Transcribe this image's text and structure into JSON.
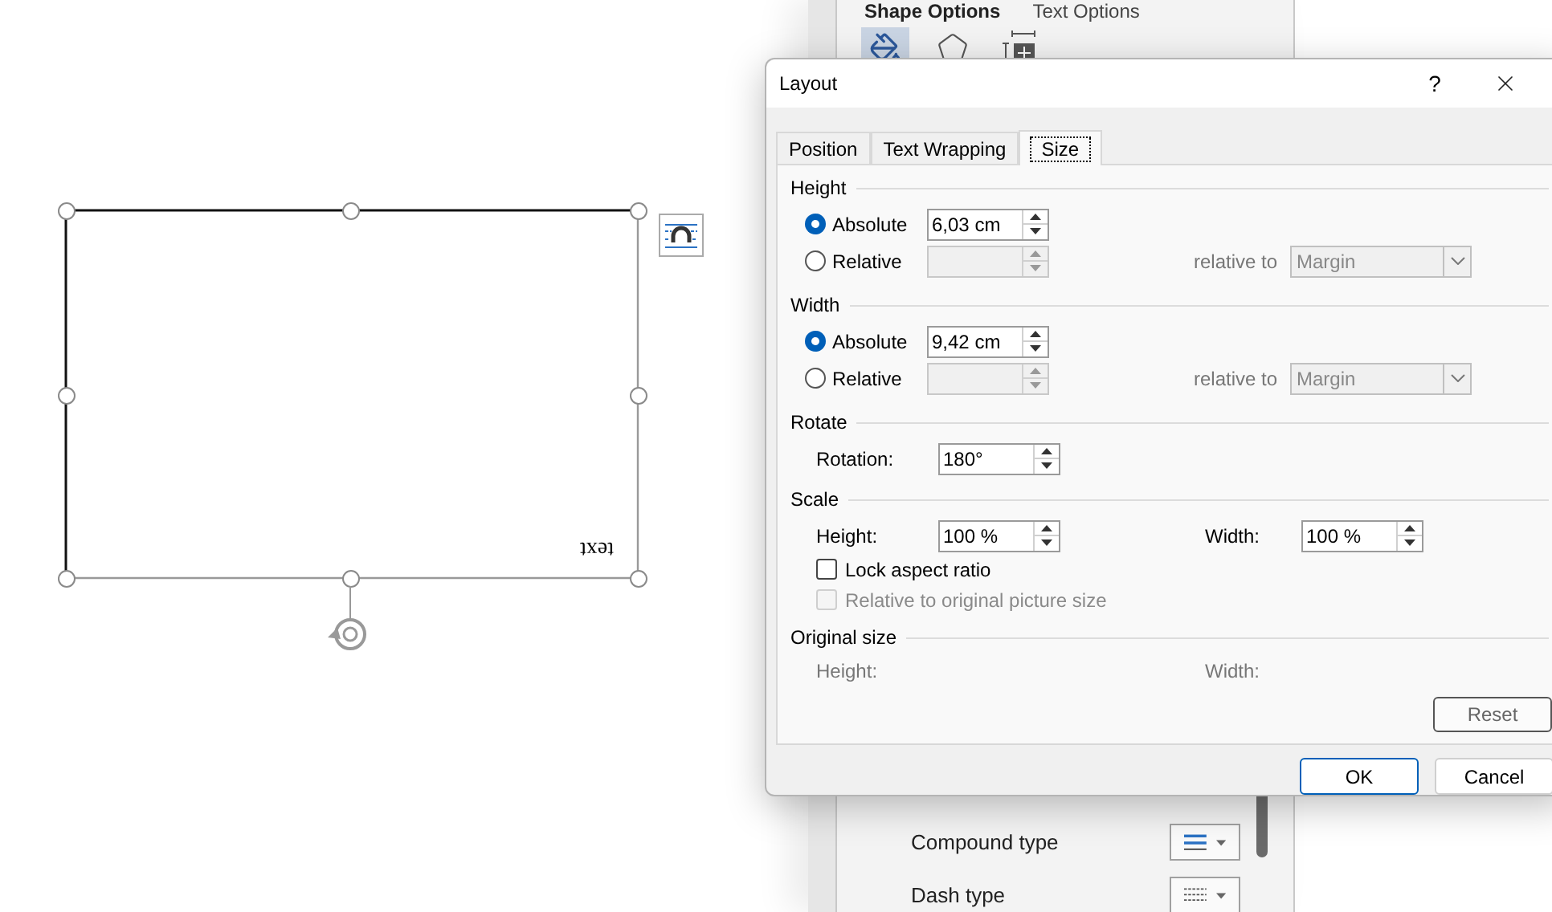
{
  "task_pane": {
    "tabs": [
      {
        "label": "Shape Options",
        "selected": true
      },
      {
        "label": "Text Options",
        "selected": false
      }
    ],
    "icons": [
      {
        "kind": "fill",
        "selected": true
      },
      {
        "kind": "effects",
        "selected": false
      },
      {
        "kind": "size",
        "selected": false
      }
    ],
    "rows": [
      {
        "label": "Compound type",
        "kind": "compound"
      },
      {
        "label": "Dash type",
        "kind": "dash"
      }
    ]
  },
  "shape": {
    "text": "text"
  },
  "dialog": {
    "title": "Layout",
    "help": "?",
    "tabs": [
      {
        "label": "Position",
        "selected": false
      },
      {
        "label": "Text Wrapping",
        "selected": false
      },
      {
        "label": "Size",
        "selected": true
      }
    ],
    "height": {
      "heading": "Height",
      "options": [
        {
          "label": "Absolute",
          "selected": true,
          "disabled": false,
          "value": "6,03 cm"
        },
        {
          "label": "Relative",
          "selected": false,
          "disabled": true
        }
      ],
      "relative_to": "relative to",
      "dropdown": {
        "value": "Margin",
        "disabled": true
      }
    },
    "width": {
      "heading": "Width",
      "options": [
        {
          "label": "Absolute",
          "selected": true,
          "disabled": false,
          "value": "9,42 cm"
        },
        {
          "label": "Relative",
          "selected": false,
          "disabled": true
        }
      ],
      "relative_to": "relative to",
      "dropdown": {
        "value": "Margin",
        "disabled": true
      }
    },
    "rotate": {
      "heading": "Rotate",
      "label": "Rotation:",
      "value": "180°"
    },
    "scale": {
      "heading": "Scale",
      "fields": [
        {
          "label": "Height:",
          "value": "100 %"
        },
        {
          "label": "Width:",
          "value": "100 %"
        }
      ],
      "checkboxes": [
        {
          "label": "Lock aspect ratio",
          "checked": false,
          "disabled": false
        },
        {
          "label": "Relative to original picture size",
          "checked": false,
          "disabled": true
        }
      ]
    },
    "original_size": {
      "heading": "Original size",
      "labels": [
        "Height:",
        "Width:"
      ]
    },
    "reset": "Reset",
    "ok": "OK",
    "cancel": "Cancel"
  }
}
